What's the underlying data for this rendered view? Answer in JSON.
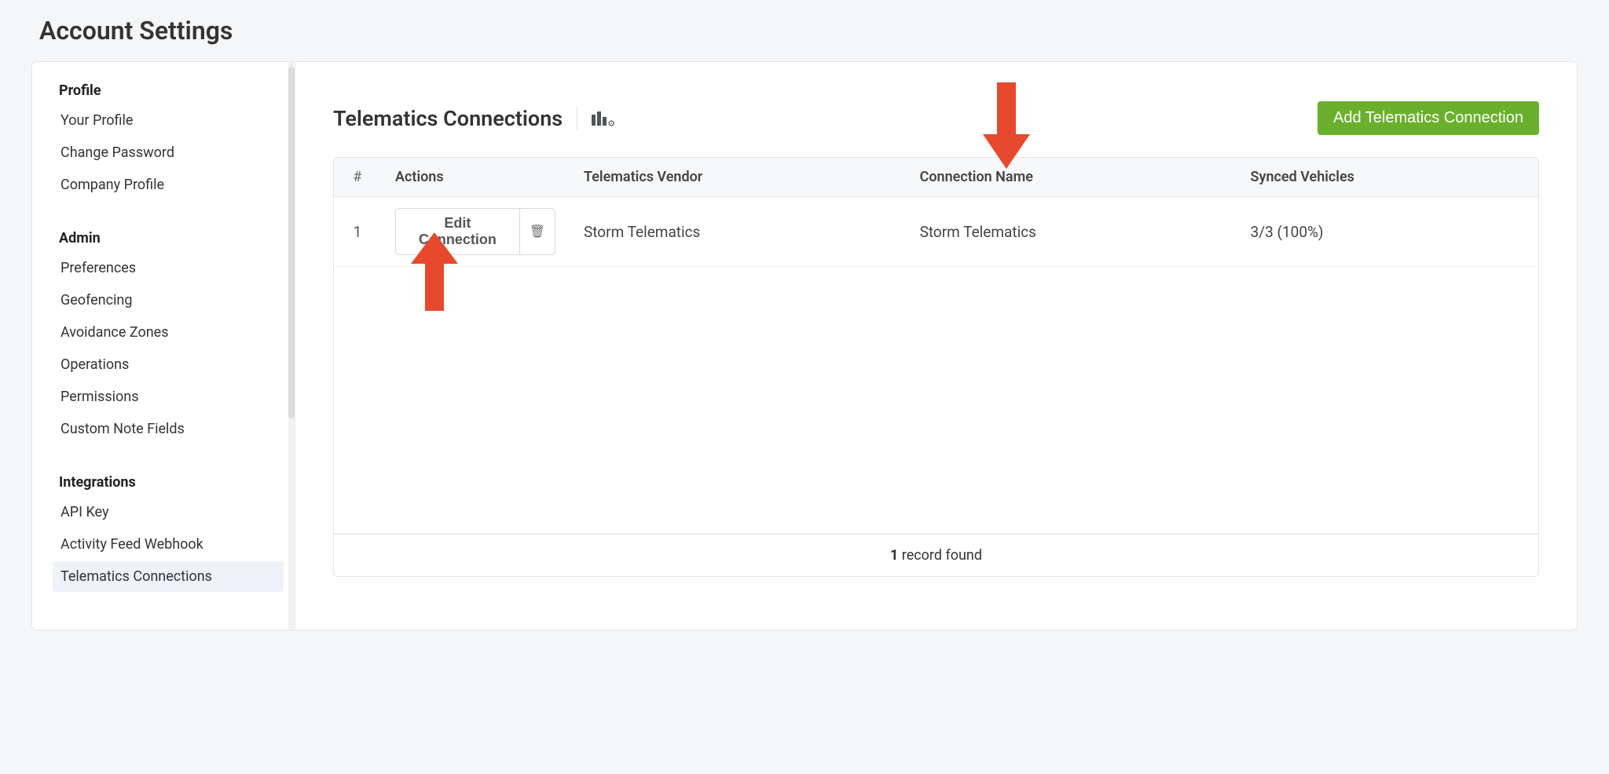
{
  "page": {
    "title": "Account Settings"
  },
  "sidebar": {
    "groups": [
      {
        "heading": "Profile",
        "items": [
          {
            "label": "Your Profile",
            "active": false
          },
          {
            "label": "Change Password",
            "active": false
          },
          {
            "label": "Company Profile",
            "active": false
          }
        ]
      },
      {
        "heading": "Admin",
        "items": [
          {
            "label": "Preferences",
            "active": false
          },
          {
            "label": "Geofencing",
            "active": false
          },
          {
            "label": "Avoidance Zones",
            "active": false
          },
          {
            "label": "Operations",
            "active": false
          },
          {
            "label": "Permissions",
            "active": false
          },
          {
            "label": "Custom Note Fields",
            "active": false
          }
        ]
      },
      {
        "heading": "Integrations",
        "items": [
          {
            "label": "API Key",
            "active": false
          },
          {
            "label": "Activity Feed Webhook",
            "active": false
          },
          {
            "label": "Telematics Connections",
            "active": true
          }
        ]
      }
    ]
  },
  "main": {
    "title": "Telematics Connections",
    "add_button": "Add Telematics Connection",
    "table": {
      "headers": {
        "num": "#",
        "actions": "Actions",
        "vendor": "Telematics Vendor",
        "name": "Connection Name",
        "synced": "Synced Vehicles"
      },
      "rows": [
        {
          "num": "1",
          "edit_label": "Edit Connection",
          "vendor": "Storm Telematics",
          "name": "Storm Telematics",
          "synced": "3/3 (100%)"
        }
      ],
      "footer_count": "1",
      "footer_text": " record found"
    }
  },
  "annotations": {
    "arrow_down_color": "#e6492d",
    "arrow_up_color": "#e6492d"
  }
}
